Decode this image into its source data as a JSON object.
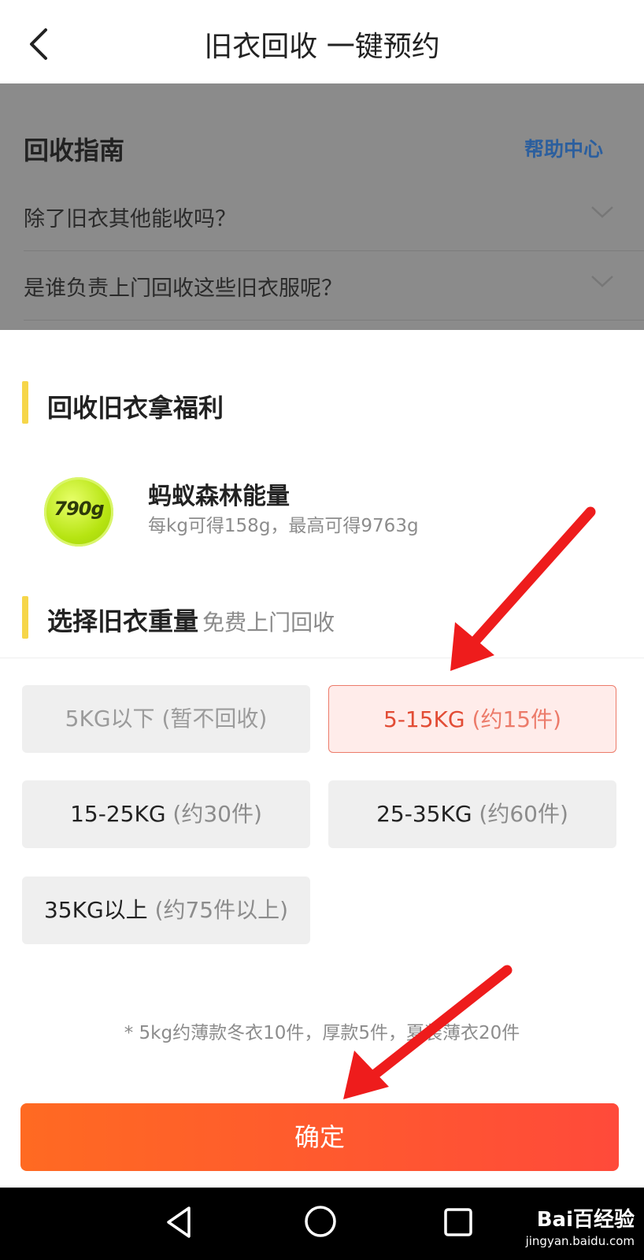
{
  "nav": {
    "title": "旧衣回收 一键预约"
  },
  "guide": {
    "title": "回收指南",
    "help_label": "帮助中心",
    "faqs": [
      {
        "question": "除了旧衣其他能收吗？"
      },
      {
        "question": "是谁负责上门回收这些旧衣服呢？"
      }
    ]
  },
  "benefit": {
    "section_title": "回收旧衣拿福利",
    "badge_value": "790g",
    "energy_title": "蚂蚁森林能量",
    "energy_desc": "每kg可得158g，最高可得9763g"
  },
  "weight": {
    "section_title": "选择旧衣重量",
    "section_sub": "免费上门回收",
    "options": [
      {
        "label": "5KG以下",
        "hint": "(暂不回收)",
        "state": "disabled"
      },
      {
        "label": "5-15KG",
        "hint": "(约15件)",
        "state": "selected"
      },
      {
        "label": "15-25KG",
        "hint": "(约30件)",
        "state": "normal"
      },
      {
        "label": "25-35KG",
        "hint": "(约60件)",
        "state": "normal"
      },
      {
        "label": "35KG以上",
        "hint": "(约75件以上)",
        "state": "normal"
      }
    ],
    "note": "* 5kg约薄款冬衣10件，厚款5件，夏装薄衣20件"
  },
  "confirm_label": "确定",
  "watermark": {
    "brand": "Bai百经验",
    "url": "jingyan.baidu.com"
  },
  "colors": {
    "accent": "#ff5a2e",
    "selected_text": "#e24c35",
    "link": "#2c5f9e",
    "section_bar": "#f6d64a",
    "arrow": "#ee1c1c"
  }
}
